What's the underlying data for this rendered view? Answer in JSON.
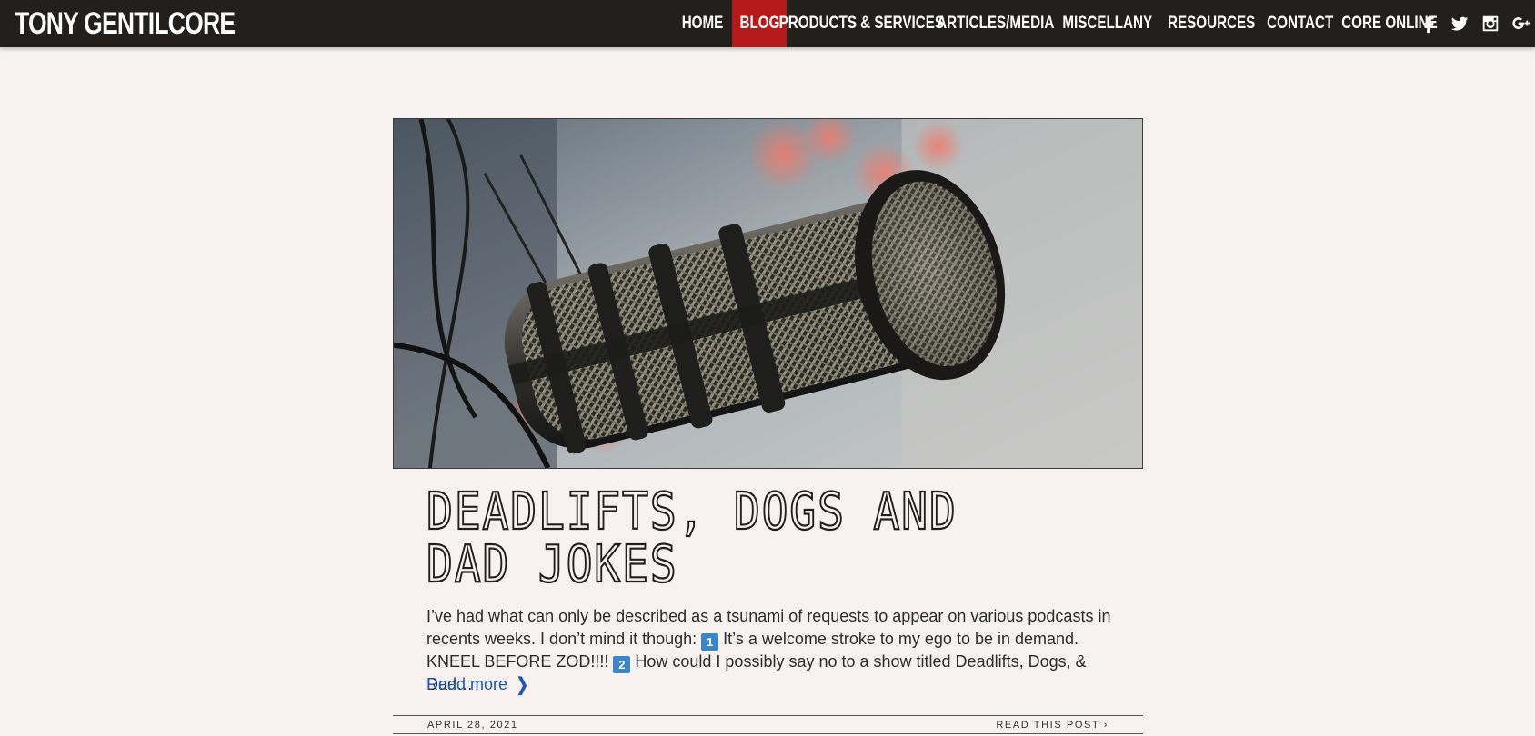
{
  "header": {
    "brand": "TONY GENTILCORE",
    "nav": [
      {
        "label": "HOME",
        "active": false
      },
      {
        "label": "BLOG",
        "active": true
      },
      {
        "label": "PRODUCTS & SERVICES",
        "active": false
      },
      {
        "label": "ARTICLES/MEDIA",
        "active": false
      },
      {
        "label": "MISCELLANY",
        "active": false
      },
      {
        "label": "RESOURCES",
        "active": false
      },
      {
        "label": "CONTACT",
        "active": false
      },
      {
        "label": "CORE ONLINE",
        "active": false
      }
    ],
    "social_icons": [
      "facebook-icon",
      "twitter-icon",
      "instagram-icon",
      "google-plus-icon"
    ]
  },
  "post": {
    "image_alt": "microphone-photo",
    "title": "DEADLIFTS, DOGS AND DAD JOKES",
    "excerpt_part1": "I’ve had what can only be described as a tsunami of requests to appear on various podcasts in recents weeks. I don’t mind it though: ",
    "num1": "1",
    "excerpt_part2": " It’s a welcome stroke to my ego to be in demand. KNEEL BEFORE ZOD!!!! ",
    "num2": "2",
    "excerpt_part3": " How could I possibly say no to a show titled Deadlifts, Dogs, & Dad…",
    "read_more": "Read more",
    "date": "APRIL 28, 2021",
    "read_this_post": "READ THIS POST ›"
  },
  "colors": {
    "header_bg": "#231f1c",
    "active_nav": "#b5191a",
    "page_bg": "#f7f2f0",
    "link": "#1d56b5",
    "emoji_num": "#3a86c9"
  }
}
